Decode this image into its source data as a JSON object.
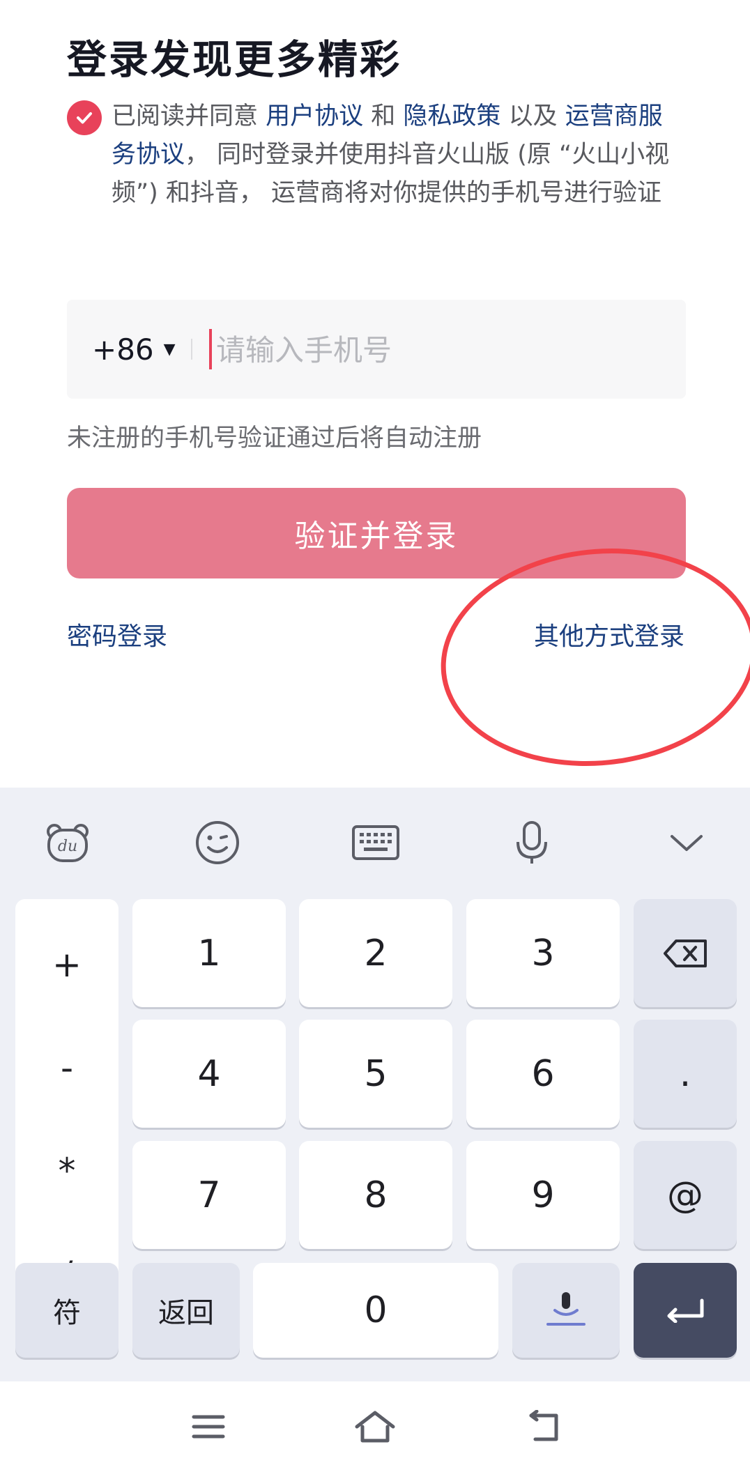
{
  "title": "登录发现更多精彩",
  "agreement": {
    "prefix": "已阅读并同意 ",
    "user_agreement": "用户协议",
    "and": " 和 ",
    "privacy_policy": "隐私政策",
    "as_well_as": " 以及 ",
    "carrier_terms": "运营商服务协议",
    "suffix": "， 同时登录并使用抖音火山版 (原 “火山小视频”) 和抖音， 运营商将对你提供的手机号进行验证"
  },
  "phone": {
    "country_code": "+86",
    "placeholder": "请输入手机号"
  },
  "hint": "未注册的手机号验证通过后将自动注册",
  "login_button": "验证并登录",
  "password_login": "密码登录",
  "other_login": "其他方式登录",
  "keyboard": {
    "symbols": [
      "+",
      "-",
      "*",
      "/"
    ],
    "digits": [
      "1",
      "2",
      "3",
      "4",
      "5",
      "6",
      "7",
      "8",
      "9"
    ],
    "zero": "0",
    "dot": ".",
    "at": "@",
    "fu": "符",
    "back": "返回",
    "toolbar_icons": [
      "baidu-bear-icon",
      "emoji-icon",
      "keyboard-icon",
      "microphone-icon",
      "chevron-down-icon"
    ]
  },
  "colors": {
    "accent": "#e8425a",
    "button": "#e67a8d",
    "link": "#1b3f7f",
    "annotation": "#f2424a"
  }
}
